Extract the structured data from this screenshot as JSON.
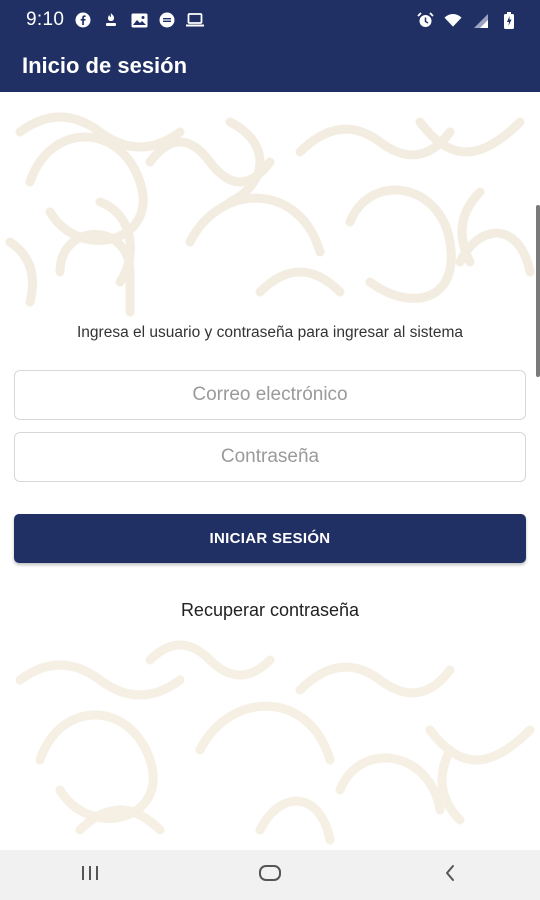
{
  "status_bar": {
    "time": "9:10",
    "left_icons": [
      "facebook-icon",
      "notification-icon",
      "image-icon",
      "message-icon",
      "laptop-icon"
    ],
    "right_icons": [
      "alarm-icon",
      "wifi-icon",
      "signal-icon",
      "battery-icon"
    ]
  },
  "appbar": {
    "title": "Inicio de sesión"
  },
  "login": {
    "instructions": "Ingresa el usuario y contraseña para ingresar al sistema",
    "email_placeholder": "Correo electrónico",
    "password_placeholder": "Contraseña",
    "submit_label": "INICIAR SESIÓN",
    "recover_label": "Recuperar contraseña"
  },
  "nav_bar": {
    "buttons": [
      "recents-icon",
      "home-icon",
      "back-icon"
    ]
  },
  "colors": {
    "primary": "#203065",
    "pattern": "#f3ede1"
  }
}
